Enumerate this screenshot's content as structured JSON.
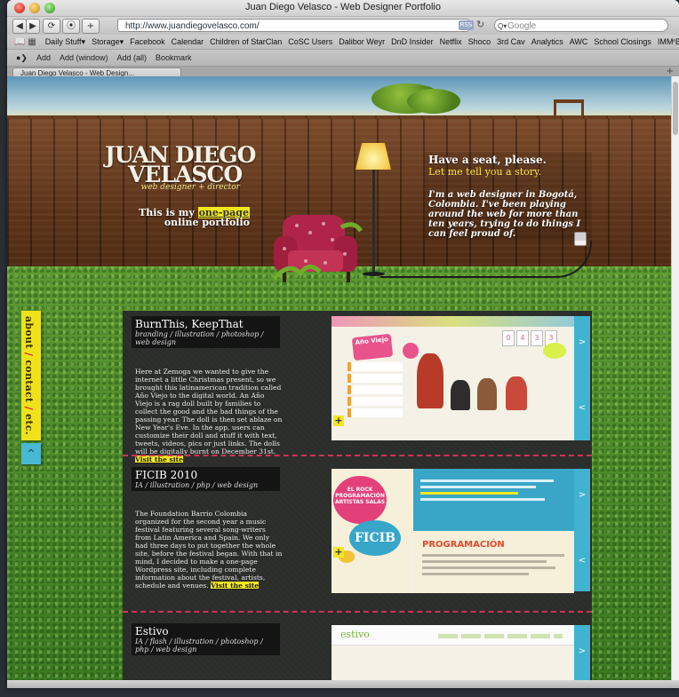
{
  "window": {
    "title": "Juan Diego Velasco - Web Designer Portfolio"
  },
  "toolbar": {
    "url": "http://www.juandiegovelasco.com/",
    "rss": "RSS",
    "search_placeholder": "Google"
  },
  "bookmarks": [
    "Daily Stuff▾",
    "Storage▾",
    "Facebook",
    "Calendar",
    "Children of StarClan",
    "CoSC Users",
    "Dalibor Weyr",
    "DnD Insider",
    "Netflix",
    "Shoco",
    "3rd Cav",
    "Analytics",
    "AWC",
    "School Closings",
    "IMM Blog"
  ],
  "bookmarks_more": "»",
  "extbar": {
    "add": "Add",
    "add_window": "Add (window)",
    "add_all": "Add (all)",
    "bookmark": "Bookmark"
  },
  "tab": {
    "label": "Juan Diego Velasco - Web Design..."
  },
  "header": {
    "logo_line1": "JUAN DIEGO",
    "logo_line2": "VELASCO",
    "logo_sub": "web designer + director",
    "portfolio_pre": "This is my ",
    "portfolio_hl": "one-page",
    "portfolio_post": "online portfolio",
    "intro_h1": "Have a seat, please.",
    "intro_h2": "Let me tell you a story.",
    "intro_p": "I'm a web designer in Bogotá, Colombia. I've been playing around the web for more than ten years, trying to do things I can feel proud of."
  },
  "sidetab": {
    "about": "about",
    "contact": "contact",
    "etc": "etc.",
    "sep": " / ",
    "up": "^"
  },
  "projects": [
    {
      "title": "BurnThis, KeepThat",
      "categories": "branding / illustration / photoshop / web design",
      "description": "Here at Zemoga we wanted to give the internet a little Christmas present, so we brought this latinamerican tradition called Año Viejo to the digital world. An Año Viejo is a rag doll built by families to collect the good and the bad things of the passing year. The doll is then set ablaze on New Year's Eve. In the app, users can customize their doll and stuff it with text, tweets, videos, pics or just links. The dolls will be digitally burnt on December 31st.",
      "link": "Visit the site"
    },
    {
      "title": "FICIB 2010",
      "categories": "IA / illustration / php / web design",
      "description": "The Foundation Barrio Colombia organized for the second year a music festival featuring several song-writers from Latin America and Spain. We only had three days to put together the whole site, before the festival began. With that in mind, I decided to make a one-page Wordpress site, including complete information about the festival, artists, schedule and venues.",
      "link": "Visit the site"
    },
    {
      "title": "Estivo",
      "categories": "IA / flash / illustration / photoshop / php / web design",
      "description": "",
      "link": ""
    }
  ],
  "controls": {
    "next": ">",
    "prev": "<",
    "plus": "+"
  },
  "shots": {
    "s1_logo": "Año Viejo",
    "s1_clock": [
      "0",
      "4",
      "3",
      "3"
    ],
    "s2_circle": "EL ROCK PROGRAMACIÓN ARTISTAS SALAS",
    "s2_ficib": "FICIB",
    "s2_title": "PROGRAMACIÓN",
    "s3_logo": "estivo"
  },
  "colors": {
    "accent_yellow": "#f2e81c",
    "accent_cyan": "#3fb3cf",
    "divider_pink": "#d0325a"
  }
}
